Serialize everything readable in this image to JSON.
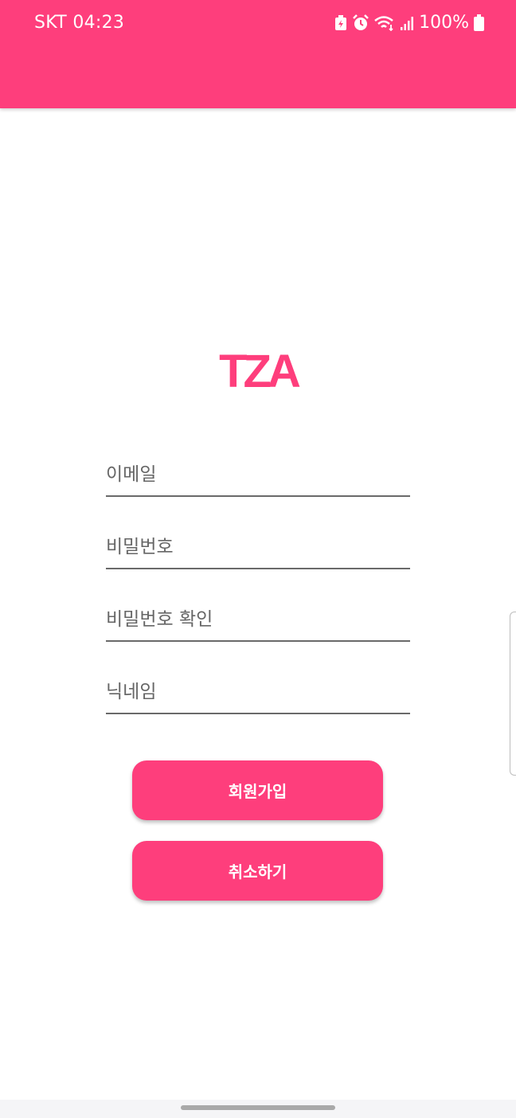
{
  "status_bar": {
    "carrier_time": "SKT 04:23",
    "battery": "100%",
    "icons": [
      "battery-saver-icon",
      "alarm-icon",
      "wifi-icon",
      "signal-icon",
      "battery-icon"
    ]
  },
  "theme": {
    "accent": "#fe3e7c",
    "field_underline": "#6a6a6a",
    "placeholder_color": "#666666"
  },
  "logo": {
    "text": "TZA"
  },
  "form": {
    "email_placeholder": "이메일",
    "password_placeholder": "비밀번호",
    "password_confirm_placeholder": "비밀번호 확인",
    "nickname_placeholder": "닉네임"
  },
  "buttons": {
    "signup_label": "회원가입",
    "cancel_label": "취소하기"
  }
}
